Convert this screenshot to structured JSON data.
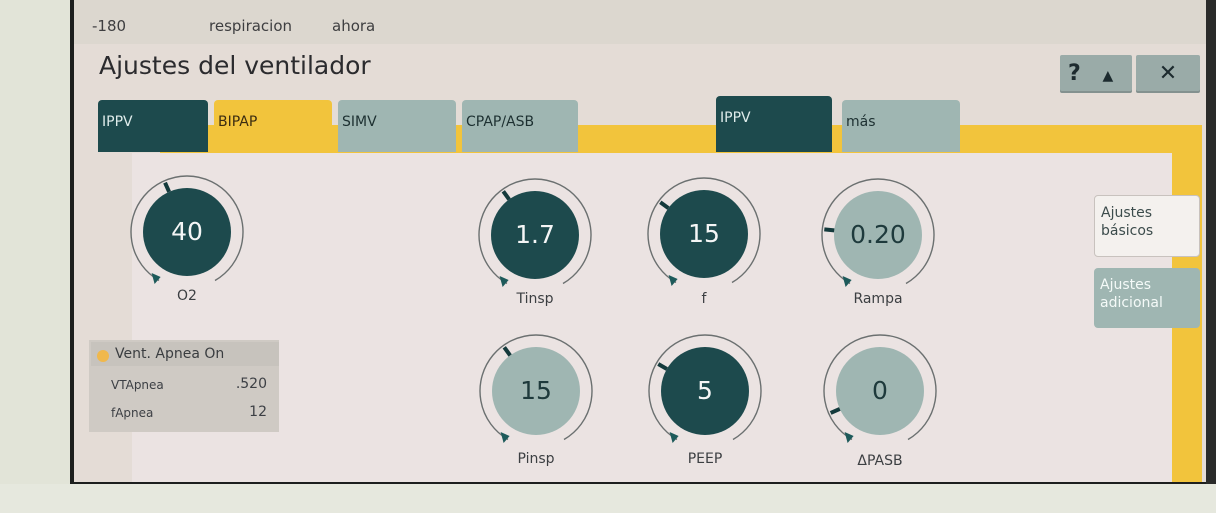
{
  "status_bar": {
    "items": [
      "-180",
      "respiracion",
      "ahora"
    ]
  },
  "header": {
    "title": "Ajustes del ventilador",
    "help_label": "?",
    "collapse_label": "▲",
    "close_label": "✕"
  },
  "tabs": {
    "left": [
      {
        "label": "IPPV",
        "state": "dark"
      },
      {
        "label": "BIPAP",
        "state": "selected"
      },
      {
        "label": "SIMV",
        "state": "inactive"
      },
      {
        "label": "CPAP/ASB",
        "state": "inactive"
      }
    ],
    "right": [
      {
        "label": "IPPV",
        "state": "dark"
      },
      {
        "label": "más",
        "state": "inactive"
      }
    ]
  },
  "side_tabs": [
    {
      "label": "Ajustes básicos",
      "active": true
    },
    {
      "label": "Ajustes adicional",
      "active": false
    }
  ],
  "knobs": [
    {
      "name": "o2",
      "value": "40",
      "label": "O2",
      "style": "dark",
      "level": 0.42
    },
    {
      "name": "tinsp",
      "value": "1.7",
      "label": "Tinsp",
      "style": "dark",
      "level": 0.38
    },
    {
      "name": "f",
      "value": "15",
      "label": "f",
      "style": "dark",
      "level": 0.32
    },
    {
      "name": "rampa",
      "value": "0.20",
      "label": "Rampa",
      "style": "light",
      "level": 0.22
    },
    {
      "name": "pinsp",
      "value": "15",
      "label": "Pinsp",
      "style": "light",
      "level": 0.38
    },
    {
      "name": "peep",
      "value": "5",
      "label": "PEEP",
      "style": "dark",
      "level": 0.3
    },
    {
      "name": "delta-pasb",
      "value": "0",
      "label": "ΔPASB",
      "style": "light",
      "level": 0.12
    }
  ],
  "apnea": {
    "title": "Vent. Apnea On",
    "rows": [
      {
        "label": "VTApnea",
        "value": ".520"
      },
      {
        "label": "fApnea",
        "value": "12"
      }
    ]
  },
  "colors": {
    "dark_teal": "#1d4a4d",
    "light_teal": "#9fb6b2",
    "accent_yellow": "#f2c43c",
    "panel": "#ebe3e2"
  }
}
